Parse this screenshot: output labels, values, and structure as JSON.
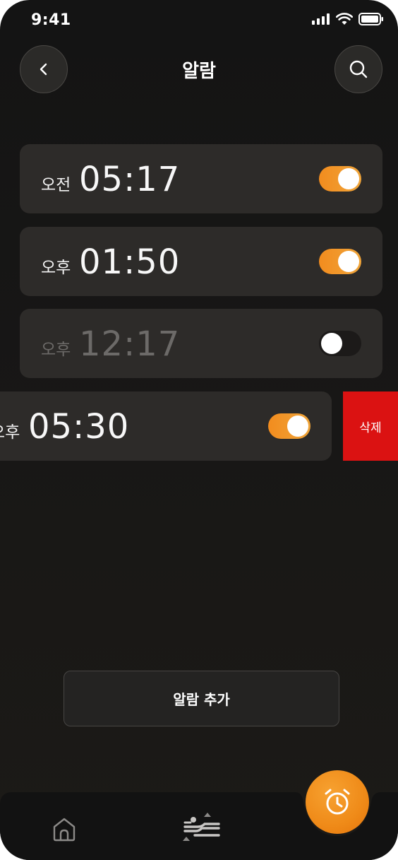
{
  "status_bar": {
    "time": "9:41"
  },
  "header": {
    "title": "알람",
    "back_icon": "chevron-left-icon",
    "search_icon": "search-icon"
  },
  "alarms": [
    {
      "period": "오전",
      "time": "05:17",
      "enabled": true
    },
    {
      "period": "오후",
      "time": "01:50",
      "enabled": true
    },
    {
      "period": "오후",
      "time": "12:17",
      "enabled": false
    },
    {
      "period": "오후",
      "time": "05:30",
      "enabled": true
    }
  ],
  "swipe_action": {
    "label": "삭제"
  },
  "add_button": {
    "label": "알람 추가"
  },
  "bottom_nav": {
    "items": [
      {
        "icon": "home-icon"
      },
      {
        "icon": "sleep-sort-icon"
      },
      {
        "icon": "alarm-clock-icon"
      }
    ]
  },
  "colors": {
    "accent": "#f28c1e",
    "delete": "#db1212",
    "card": "#2d2b29",
    "background": "#161514"
  }
}
